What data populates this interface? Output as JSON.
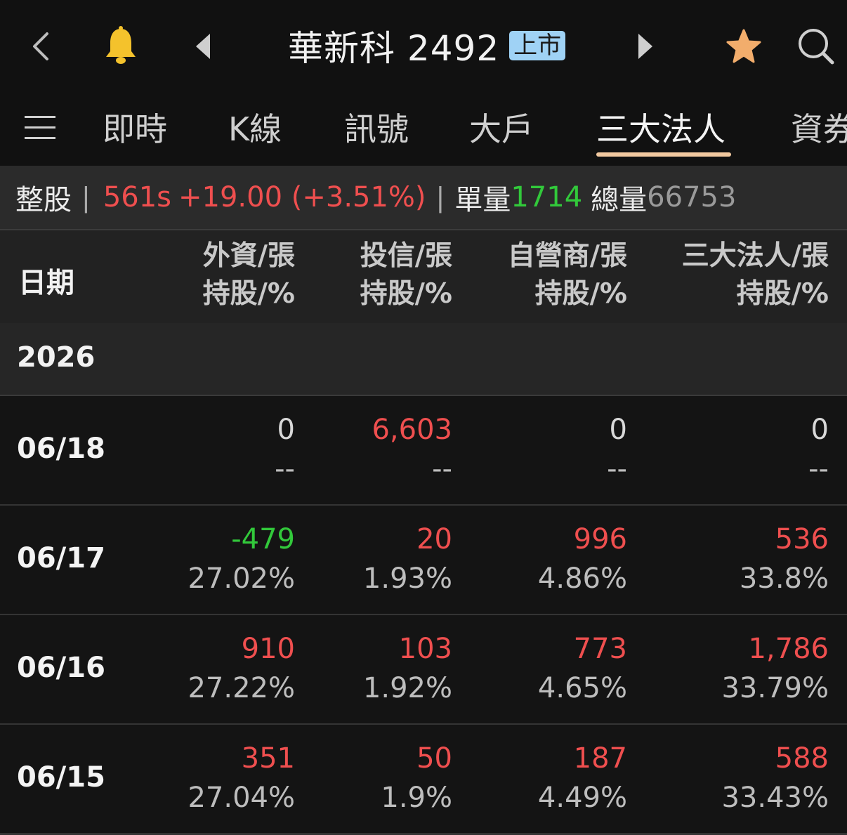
{
  "header": {
    "title": "華新科 2492",
    "badge": "上市",
    "icons": [
      "back-arrow-icon",
      "bell-icon",
      "prev-triangle-icon",
      "next-triangle-icon",
      "star-icon",
      "search-icon"
    ]
  },
  "tabs": [
    "即時",
    "K線",
    "訊號",
    "大戶",
    "三大法人",
    "資券"
  ],
  "active_tab": "三大法人",
  "summary": {
    "label": "整股",
    "price": "561s",
    "change": "+19.00 (+3.51%)",
    "single_vol_label": "單量",
    "single_vol": "1714",
    "total_vol_label": "總量",
    "total_vol": "66753"
  },
  "columns": {
    "date": "日期",
    "foreign_top": "外資/張",
    "foreign_bottom": "持股/%",
    "trust_top": "投信/張",
    "trust_bottom": "持股/%",
    "dealer_top": "自營商/張",
    "dealer_bottom": "持股/%",
    "total_top": "三大法人/張",
    "total_bottom": "持股/%"
  },
  "year": "2026",
  "rows": [
    {
      "date": "06/18",
      "foreign": {
        "v": "0",
        "p": "--",
        "c": "#d8d8d8"
      },
      "trust": {
        "v": "6,603",
        "p": "--",
        "c": "#ef4f4f"
      },
      "dealer": {
        "v": "0",
        "p": "--",
        "c": "#d8d8d8"
      },
      "total": {
        "v": "0",
        "p": "--",
        "c": "#d8d8d8"
      }
    },
    {
      "date": "06/17",
      "foreign": {
        "v": "-479",
        "p": "27.02%",
        "c": "#32c93b"
      },
      "trust": {
        "v": "20",
        "p": "1.93%",
        "c": "#ef4f4f"
      },
      "dealer": {
        "v": "996",
        "p": "4.86%",
        "c": "#ef4f4f"
      },
      "total": {
        "v": "536",
        "p": "33.8%",
        "c": "#ef4f4f"
      }
    },
    {
      "date": "06/16",
      "foreign": {
        "v": "910",
        "p": "27.22%",
        "c": "#ef4f4f"
      },
      "trust": {
        "v": "103",
        "p": "1.92%",
        "c": "#ef4f4f"
      },
      "dealer": {
        "v": "773",
        "p": "4.65%",
        "c": "#ef4f4f"
      },
      "total": {
        "v": "1,786",
        "p": "33.79%",
        "c": "#ef4f4f"
      }
    },
    {
      "date": "06/15",
      "foreign": {
        "v": "351",
        "p": "27.04%",
        "c": "#ef4f4f"
      },
      "trust": {
        "v": "50",
        "p": "1.9%",
        "c": "#ef4f4f"
      },
      "dealer": {
        "v": "187",
        "p": "4.49%",
        "c": "#ef4f4f"
      },
      "total": {
        "v": "588",
        "p": "33.43%",
        "c": "#ef4f4f"
      }
    }
  ]
}
